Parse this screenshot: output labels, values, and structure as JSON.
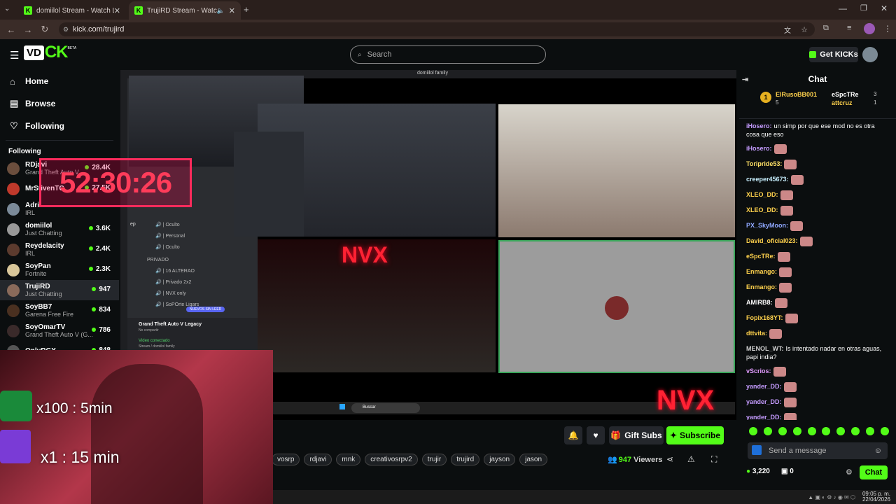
{
  "browser": {
    "tabs": [
      {
        "title": "domiilol Stream - Watch Live o"
      },
      {
        "title": "TrujiRD Stream - Watch Live"
      }
    ],
    "url": "kick.com/trujird"
  },
  "header": {
    "search_placeholder": "Search",
    "kicks_label": "Get KICKs",
    "logo_text": "CK",
    "beta": "BETA"
  },
  "sidebar": {
    "nav": [
      {
        "label": "Home",
        "icon": "home-icon"
      },
      {
        "label": "Browse",
        "icon": "browse-icon"
      },
      {
        "label": "Following",
        "icon": "heart-icon"
      }
    ],
    "following_header": "Following",
    "channels": [
      {
        "name": "RDjavi",
        "category": "Grand Theft Auto V",
        "viewers": "28.4K",
        "color": "#6b4e3d"
      },
      {
        "name": "MrStivenTC",
        "category": "",
        "viewers": "27.5K",
        "color": "#c0392b"
      },
      {
        "name": "Adri",
        "category": "IRL",
        "viewers": "",
        "color": "#7b8a99"
      },
      {
        "name": "domiilol",
        "category": "Just Chatting",
        "viewers": "3.6K",
        "color": "#999"
      },
      {
        "name": "Reydelacity",
        "category": "IRL",
        "viewers": "2.4K",
        "color": "#5c3b2e"
      },
      {
        "name": "SoyPan",
        "category": "Fortnite",
        "viewers": "2.3K",
        "color": "#d9c79a"
      },
      {
        "name": "TrujiRD",
        "category": "Just Chatting",
        "viewers": "947",
        "color": "#8a6a5a"
      },
      {
        "name": "SoyBB7",
        "category": "Garena Free Fire",
        "viewers": "834",
        "color": "#4a3020"
      },
      {
        "name": "SoyOmarTV",
        "category": "Grand Theft Auto V (G...",
        "viewers": "786",
        "color": "#3a2a2a"
      },
      {
        "name": "OnlyRGX",
        "category": "",
        "viewers": "848",
        "color": "#555"
      }
    ]
  },
  "overlay": {
    "timer": "52:30:26",
    "sub1": "x100 : 5min",
    "sub2": "x1 : 15 min",
    "nvx": "NVX"
  },
  "discord": {
    "title": "domiilol family",
    "channels": [
      "Oculto",
      "Personal",
      "Oculto"
    ],
    "privado": "PRIVADO",
    "private_channels": [
      "16 ALTERAO",
      "Privado 2x2",
      "NVX only",
      "SoPOrte Ligars"
    ],
    "new_badge": "NUEVOS SIN LEER",
    "game": "Grand Theft Auto V Legacy",
    "game_sub": "No compartir",
    "video": "Video conectado",
    "video_sub": "Stream / domiilol family",
    "ep": "ep"
  },
  "win_taskbar": {
    "search": "Buscar",
    "time": "09:05 p. m.",
    "date": "22/04/2026"
  },
  "info": {
    "gift_label": "Gift Subs",
    "subscribe_label": "Subscribe",
    "tags": [
      "vosrp",
      "rdjavi",
      "mnk",
      "creativosrpv2",
      "trujir",
      "trujird",
      "jayson",
      "jason"
    ],
    "viewers": "947",
    "viewers_label": "Viewers"
  },
  "chat": {
    "title": "Chat",
    "top": {
      "leader": "ElRusoBB001",
      "leader_count": "5",
      "g1": "eSpcTRe",
      "g1c": "3",
      "g2": "attcruz",
      "g2c": "1",
      "rank": "1"
    },
    "messages": [
      {
        "user": "iHosero:",
        "text": "un simp por que ese mod no es otra cosa que eso",
        "color": "#c59cff"
      },
      {
        "user": "iHosero:",
        "text": "",
        "color": "#c59cff"
      },
      {
        "user": "Toripride53:",
        "text": "",
        "color": "#ffe066"
      },
      {
        "user": "creeper45673:",
        "text": "",
        "color": "#c8f0ff"
      },
      {
        "user": "XLEO_DD:",
        "text": "",
        "color": "#ffd24d"
      },
      {
        "user": "XLEO_DD:",
        "text": "",
        "color": "#ffd24d"
      },
      {
        "user": "PX_SkyMoon:",
        "text": "",
        "color": "#8fa8ff"
      },
      {
        "user": "David_oficial023:",
        "text": "",
        "color": "#ffd24d"
      },
      {
        "user": "eSpcTRe:",
        "text": "",
        "color": "#ffd24d"
      },
      {
        "user": "Enmango:",
        "text": "",
        "color": "#ffd24d"
      },
      {
        "user": "Enmango:",
        "text": "",
        "color": "#ffd24d"
      },
      {
        "user": "AMIRB8:",
        "text": "",
        "color": "#ffffff"
      },
      {
        "user": "Fopix168YT:",
        "text": "",
        "color": "#ffd24d"
      },
      {
        "user": "dttvita:",
        "text": "",
        "color": "#ffd24d"
      },
      {
        "user": "MENOL_WT:",
        "text": "Is intentado nadar en otras aguas, papi india?",
        "color": "#d0d0d0"
      },
      {
        "user": "vScrios:",
        "text": "",
        "color": "#e29cff"
      },
      {
        "user": "yander_DD:",
        "text": "",
        "color": "#c59cff"
      },
      {
        "user": "yander_DD:",
        "text": "",
        "color": "#c59cff"
      },
      {
        "user": "yander_DD:",
        "text": "",
        "color": "#c59cff"
      }
    ],
    "input_placeholder": "Send a message",
    "points": "3,220",
    "gifts": "0",
    "send_label": "Chat"
  }
}
